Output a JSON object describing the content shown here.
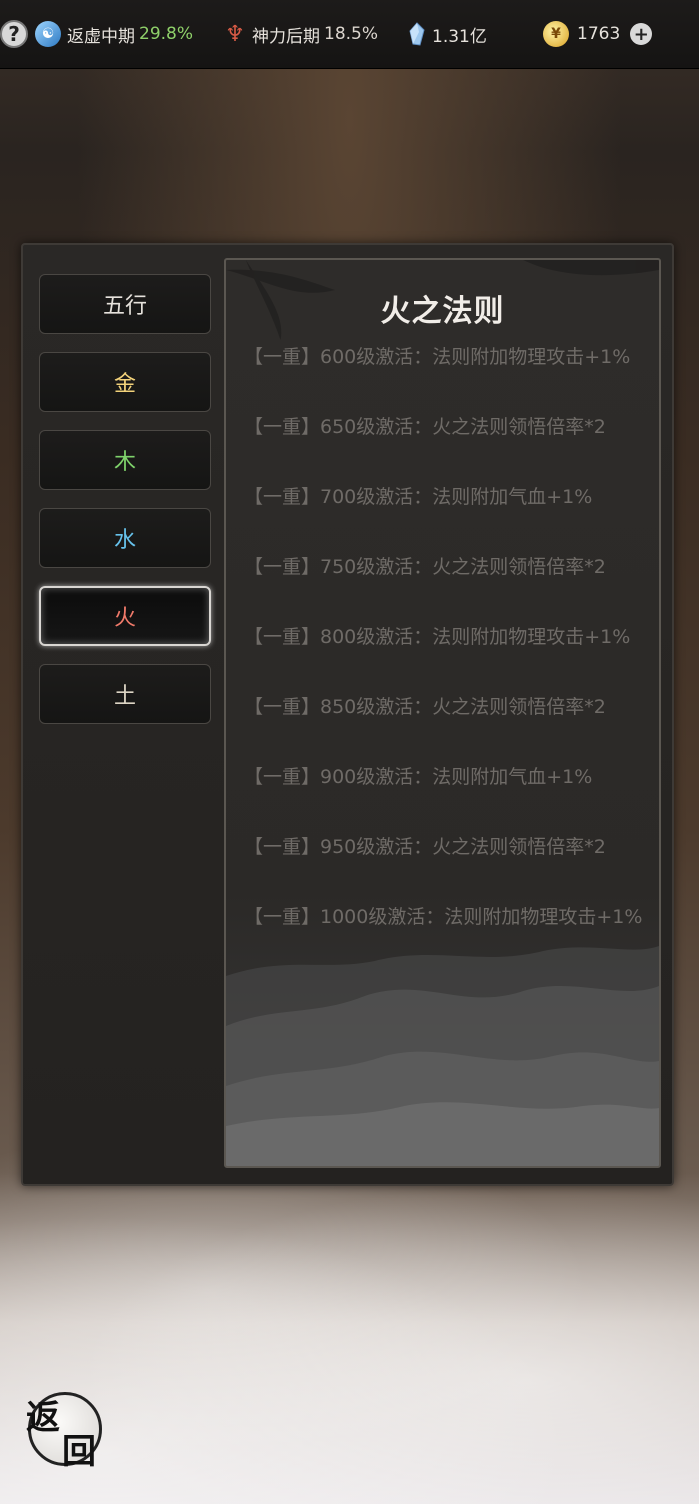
{
  "topbar": {
    "cultivation_label": "返虚中期",
    "cultivation_percent": "29.8%",
    "divine_label": "神力后期",
    "divine_percent": "18.5%",
    "crystal_amount": "1.31亿",
    "coin_amount": "1763"
  },
  "icons": {
    "help": "?",
    "taiji": "☯",
    "divine": "♆",
    "coin": "¥",
    "plus": "+"
  },
  "tabs": [
    {
      "label": "五行",
      "color": "#e6e2dc"
    },
    {
      "label": "金",
      "color": "#f2d27a"
    },
    {
      "label": "木",
      "color": "#7fd36b"
    },
    {
      "label": "水",
      "color": "#67c2ec"
    },
    {
      "label": "火",
      "color": "#f07a6a",
      "active": true
    },
    {
      "label": "土",
      "color": "#ddd5c5"
    }
  ],
  "content": {
    "title": "火之法则",
    "rules": [
      "【一重】600级激活：法则附加物理攻击+1%",
      "【一重】650级激活：火之法则领悟倍率*2",
      "【一重】700级激活：法则附加气血+1%",
      "【一重】750级激活：火之法则领悟倍率*2",
      "【一重】800级激活：法则附加物理攻击+1%",
      "【一重】850级激活：火之法则领悟倍率*2",
      "【一重】900级激活：法则附加气血+1%",
      "【一重】950级激活：火之法则领悟倍率*2",
      "【一重】1000级激活：法则附加物理攻击+1%"
    ]
  },
  "back_button": {
    "char1": "返",
    "char2": "回"
  }
}
